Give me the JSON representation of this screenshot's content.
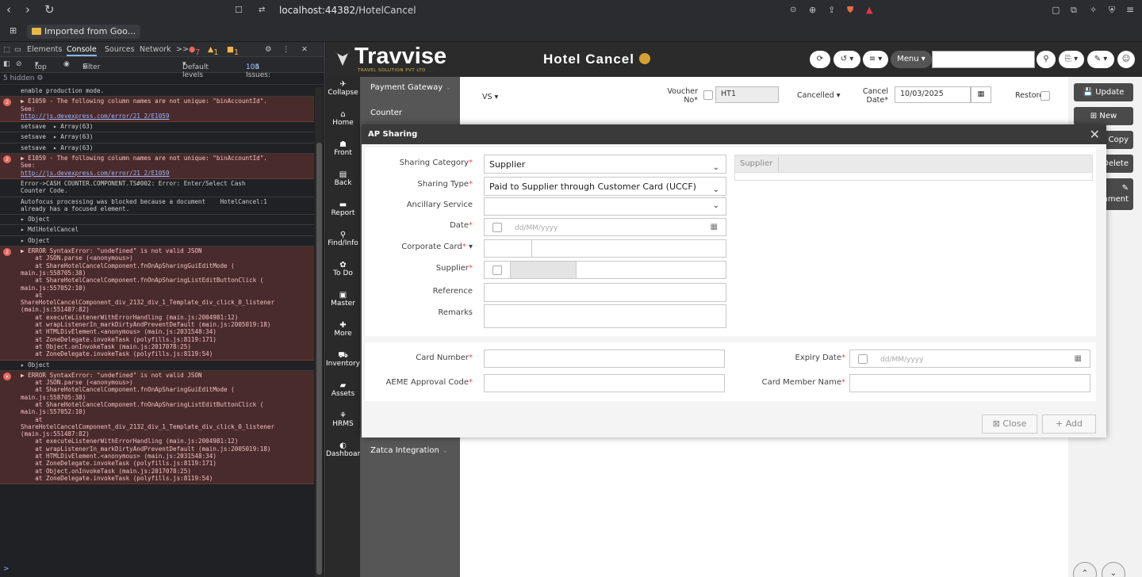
{
  "browser": {
    "url_host": "localhost:44382",
    "url_path": "/HotelCancel",
    "bookmark": "Imported from Goo..."
  },
  "devtools": {
    "tabs": [
      "Elements",
      "Console",
      "Sources",
      "Network"
    ],
    "more_tabs": ">>",
    "badge_errors": "7",
    "badge_warnings": "1",
    "badge_info": "1",
    "context": "top",
    "filter_placeholder": "Filter",
    "levels": "Default levels",
    "issues": "105 Issues:",
    "issues_a": "1",
    "issues_b": "104",
    "hidden": "5 hidden",
    "prompt": ">",
    "messages": [
      {
        "type": "log",
        "text": "enable production mode."
      },
      {
        "type": "err",
        "badge": "2",
        "text": "▶ E1059 - The following column names are not unique: \"binAccountId\".\nSee:",
        "link": "http://js.devexpress.com/error/21_2/E1059"
      },
      {
        "type": "log",
        "text": "setsave  ▸ Array(63)"
      },
      {
        "type": "log",
        "text": "setsave  ▸ Array(63)"
      },
      {
        "type": "log",
        "text": "setsave  ▸ Array(63)"
      },
      {
        "type": "err",
        "badge": "2",
        "text": "▶ E1059 - The following column names are not unique: \"binAccountId\".\nSee:",
        "link": "http://js.devexpress.com/error/21_2/E1059"
      },
      {
        "type": "log",
        "text": "Error->CASH COUNTER.COMPONENT.TS#002: Error: Enter/Select Cash\nCounter Code."
      },
      {
        "type": "log",
        "text": "Autofocus processing was blocked because a document    HotelCancel:1\nalready has a focused element."
      },
      {
        "type": "log",
        "text": "▸ Object"
      },
      {
        "type": "log",
        "text": "▸ MdlHotelCancel"
      },
      {
        "type": "log",
        "text": "▸ Object"
      },
      {
        "type": "err",
        "badge": "2",
        "text": "▶ ERROR SyntaxError: \"undefined\" is not valid JSON\n    at JSON.parse (<anonymous>)\n    at ShareHotelCancelComponent.fnOnApSharingGuiEditMode (\nmain.js:558705:38)\n    at ShareHotelCancelComponent.fnOnApSharingListEditButtonClick (\nmain.js:557052:10)\n    at\nShareHotelCancelComponent_div_2132_div_1_Template_div_click_0_listener\n(main.js:551487:82)\n    at executeListenerWithErrorHandling (main.js:2004981:12)\n    at wrapListenerIn_markDirtyAndPreventDefault (main.js:2005019:18)\n    at HTMLDivElement.<anonymous> (main.js:2031548:34)\n    at ZoneDelegate.invokeTask (polyfills.js:8119:171)\n    at Object.onInvokeTask (main.js:2017078:25)\n    at ZoneDelegate.invokeTask (polyfills.js:8119:54)"
      },
      {
        "type": "log",
        "text": "▸ Object"
      },
      {
        "type": "err",
        "badge": "✕",
        "text": "▶ ERROR SyntaxError: \"undefined\" is not valid JSON\n    at JSON.parse (<anonymous>)\n    at ShareHotelCancelComponent.fnOnApSharingGuiEditMode (\nmain.js:558705:38)\n    at ShareHotelCancelComponent.fnOnApSharingListEditButtonClick (\nmain.js:557052:10)\n    at\nShareHotelCancelComponent_div_2132_div_1_Template_div_click_0_listener\n(main.js:551487:82)\n    at executeListenerWithErrorHandling (main.js:2004981:12)\n    at wrapListenerIn_markDirtyAndPreventDefault (main.js:2005019:18)\n    at HTMLDivElement.<anonymous> (main.js:2031548:34)\n    at ZoneDelegate.invokeTask (polyfills.js:8119:171)\n    at Object.onInvokeTask (main.js:2017078:25)\n    at ZoneDelegate.invokeTask (polyfills.js:8119:54)"
      }
    ]
  },
  "app": {
    "logo": "Travvise",
    "logo_sub": "TRAVEL SOLUTION PVT LTD",
    "title": "Hotel Cancel",
    "menu": "Menu",
    "sidebar": [
      "Collapse",
      "Home",
      "Front",
      "Back",
      "Report",
      "Find/Info",
      "To Do",
      "Master",
      "More",
      "Inventory",
      "Assets",
      "HRMS",
      "Dashboard"
    ],
    "submenu": [
      "Payment Gateway",
      "Counter",
      "Zatca Integration"
    ],
    "right_buttons": [
      "Update",
      "New",
      "Copy",
      "Delete",
      "hment"
    ],
    "form": {
      "vs": "VS",
      "voucher_label": "Voucher",
      "voucher_label2": "No*",
      "voucher_value": "HT1",
      "status": "Cancelled",
      "cancel_label": "Cancel",
      "cancel_label2": "Date*",
      "cancel_date": "10/03/2025",
      "restore": "Restore"
    }
  },
  "modal": {
    "title": "AP Sharing",
    "close_x": "✕",
    "sharing_category_label": "Sharing Category",
    "sharing_category": "Supplier",
    "sharing_type_label": "Sharing Type",
    "sharing_type": "Paid to Supplier through Customer Card (UCCF)",
    "ancillary_label": "Ancillary Service",
    "date_label": "Date",
    "date_placeholder": "dd/MM/yyyy",
    "corporate_card_label": "Corporate Card",
    "supplier_label": "Supplier",
    "reference_label": "Reference",
    "remarks_label": "Remarks",
    "supplier_grid_header": "Supplier",
    "card_number_label": "Card Number",
    "expiry_label": "Expiry Date",
    "expiry_placeholder": "dd/MM/yyyy",
    "aeme_label": "AEME Approval Code",
    "card_member_label": "Card Member Name",
    "close_btn": "Close",
    "add_btn": "+ Add"
  }
}
